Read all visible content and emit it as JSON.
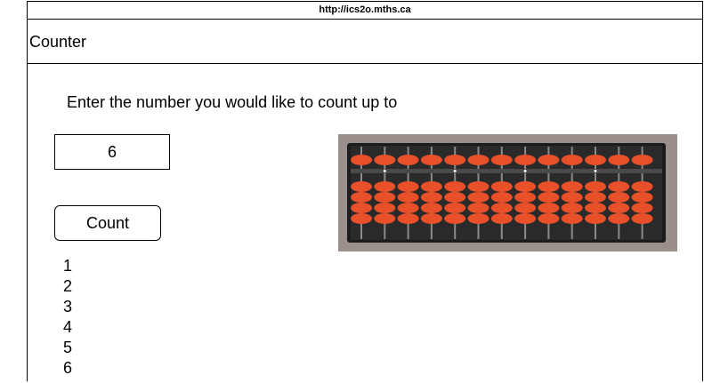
{
  "browser": {
    "url": "http://ics2o.mths.ca"
  },
  "header": {
    "title": "Counter"
  },
  "form": {
    "prompt": "Enter the number you would like to count up to",
    "input_value": "6",
    "button_label": "Count"
  },
  "results": [
    "1",
    "2",
    "3",
    "4",
    "5",
    "6"
  ],
  "image": {
    "icon": "abacus-image",
    "bead_color": "#e8502a",
    "frame_color": "#1c1c1c",
    "background_color": "#9a8f8a"
  }
}
